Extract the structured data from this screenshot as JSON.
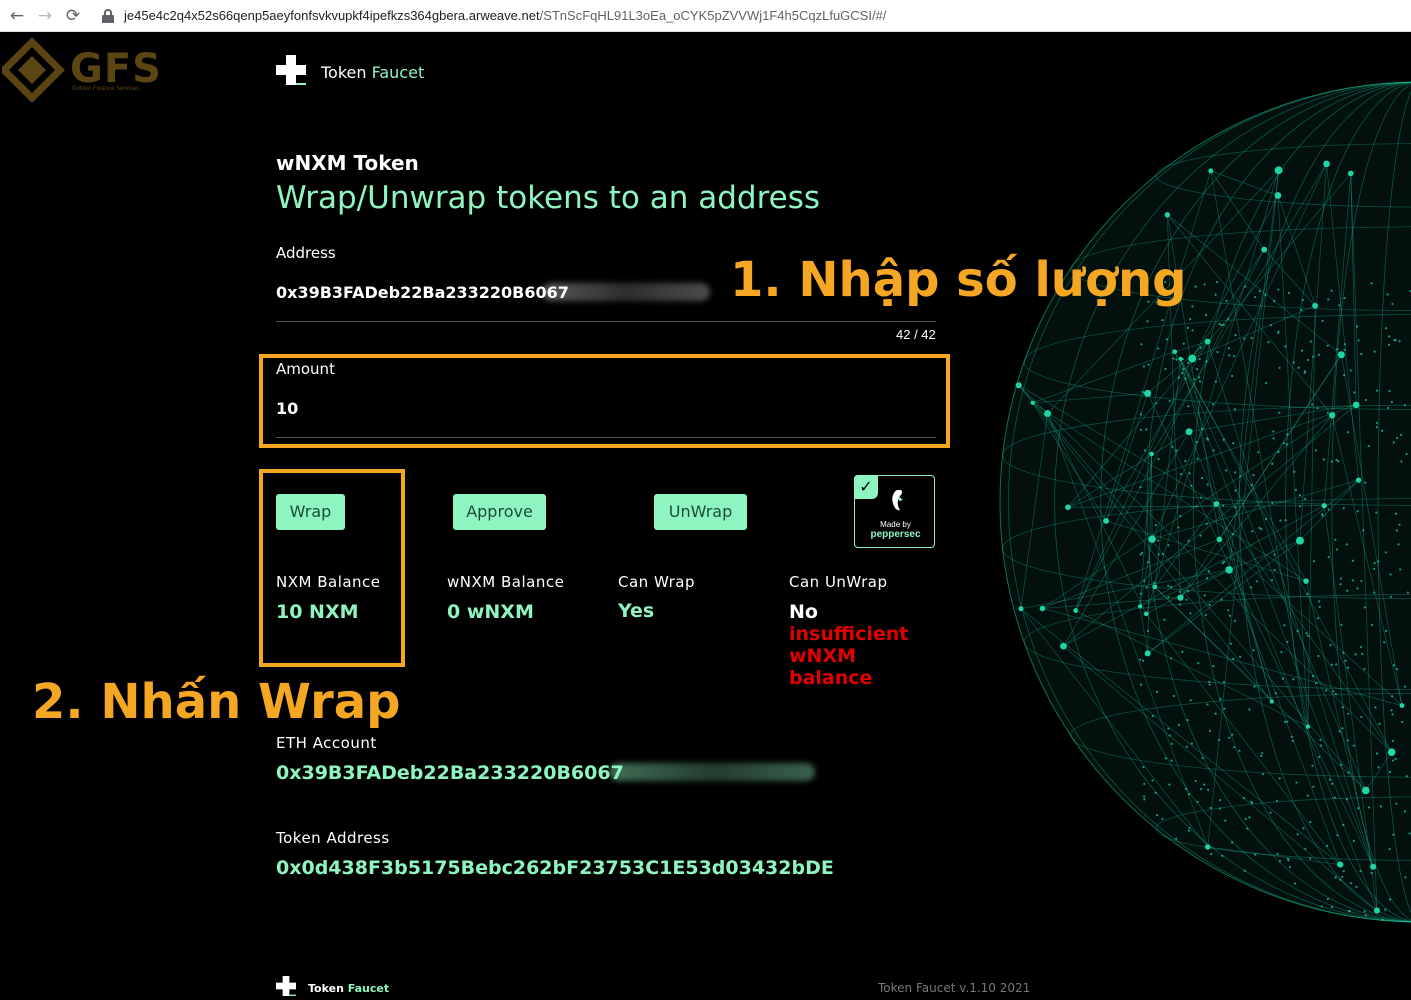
{
  "browser": {
    "url_host": "je45e4c2q4x52s66qenp5aeyfonfsvkvupkf4ipefkzs364gbera.arweave.net",
    "url_path": "/STnScFqHL91L3oEa_oCYK5pZVVWj1F4h5CqzLfuGCSI/#/"
  },
  "watermark": {
    "name": "GFS",
    "subtitle": "Golden Finance Services"
  },
  "header": {
    "brand_first": "Token",
    "brand_second": "Faucet"
  },
  "page": {
    "title": "wNXM Token",
    "subtitle": "Wrap/Unwrap tokens to an address"
  },
  "form": {
    "address_label": "Address",
    "address_value": "0x39B3FADeb22Ba233220B6067",
    "address_counter": "42 / 42",
    "amount_label": "Amount",
    "amount_value": "10"
  },
  "buttons": {
    "wrap": "Wrap",
    "approve": "Approve",
    "unwrap": "UnWrap"
  },
  "badge": {
    "made_by": "Made by",
    "brand": "peppersec"
  },
  "stats": {
    "nxm_balance_label": "NXM Balance",
    "nxm_balance_value": "10 NXM",
    "wnxm_balance_label": "wNXM Balance",
    "wnxm_balance_value": "0 wNXM",
    "can_wrap_label": "Can Wrap",
    "can_wrap_value": "Yes",
    "can_unwrap_label": "Can UnWrap",
    "can_unwrap_value": "No",
    "can_unwrap_reason": "insufficient wNXM balance"
  },
  "account": {
    "eth_label": "ETH Account",
    "eth_value": "0x39B3FADeb22Ba233220B6067",
    "token_label": "Token Address",
    "token_value": "0x0d438F3b5175Bebc262bF23753C1E53d03432bDE"
  },
  "annotations": {
    "step1": "1. Nhập số lượng",
    "step2": "2. Nhấn Wrap"
  },
  "footer": {
    "brand_first": "Token",
    "brand_second": "Faucet",
    "version": "Token Faucet v.1.10 2021"
  },
  "colors": {
    "accent": "#8ff5c0",
    "annotation": "#f5a623",
    "error": "#e00000",
    "globe": "#1fd6a8"
  }
}
